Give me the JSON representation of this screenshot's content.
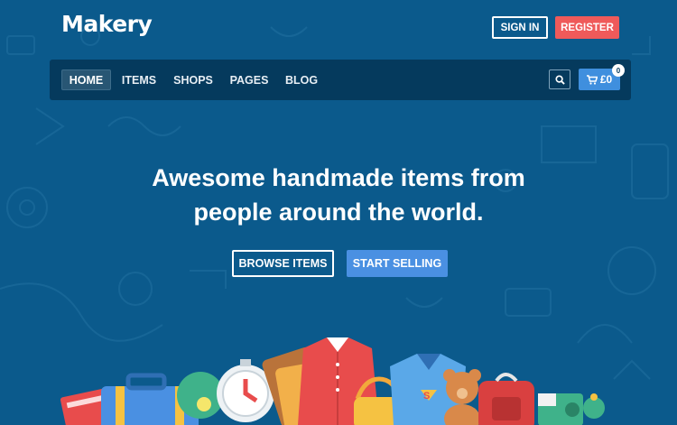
{
  "brand": {
    "logo": "Makery"
  },
  "auth": {
    "sign_in": "SIGN IN",
    "register": "REGISTER"
  },
  "nav": {
    "items": [
      {
        "label": "HOME",
        "active": true
      },
      {
        "label": "ITEMS"
      },
      {
        "label": "SHOPS"
      },
      {
        "label": "PAGES"
      },
      {
        "label": "BLOG"
      }
    ],
    "search_icon": "search-icon",
    "cart": {
      "icon": "cart-icon",
      "total": "£0",
      "count": "0"
    }
  },
  "hero": {
    "line1": "Awesome handmade items from",
    "line2": "people around the world.",
    "browse": "BROWSE ITEMS",
    "sell": "START SELLING"
  },
  "colors": {
    "background": "#0b5a8c",
    "navbar": "#053a5d",
    "register": "#ef5a5a",
    "accent_blue": "#4a90e2"
  }
}
